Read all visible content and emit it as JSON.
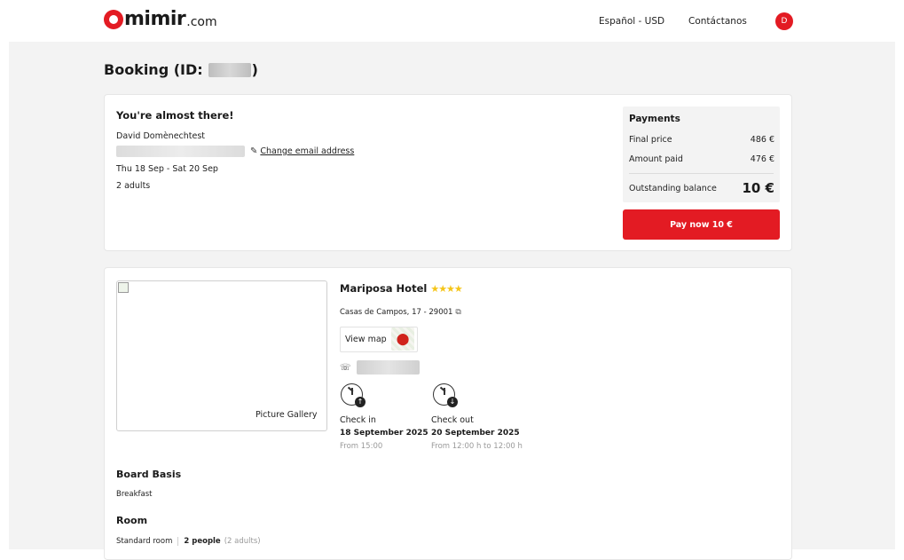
{
  "header": {
    "logo_word": "mimir",
    "logo_suffix": ".com",
    "language": "Español - USD",
    "contact": "Contáctanos",
    "avatar_initial": "D"
  },
  "booking": {
    "title_prefix": "Booking (ID:",
    "title_suffix": ")"
  },
  "summary": {
    "heading": "You're almost there!",
    "guest_name": "David Domènechtest",
    "change_email": "Change email address",
    "dates": "Thu 18 Sep - Sat 20 Sep",
    "guests": "2 adults"
  },
  "payments": {
    "title": "Payments",
    "final_price_label": "Final price",
    "final_price_value": "486 €",
    "amount_paid_label": "Amount paid",
    "amount_paid_value": "476 €",
    "outstanding_label": "Outstanding balance",
    "outstanding_value": "10 €",
    "pay_button": "Pay now 10 €"
  },
  "hotel": {
    "name": "Mariposa Hotel",
    "stars": "★★★★",
    "address": "Casas de Campos, 17 - 29001",
    "view_map": "View map",
    "gallery_label": "Picture Gallery",
    "check_in_label": "Check in",
    "check_in_date": "18 September 2025",
    "check_in_time": "From 15:00",
    "check_out_label": "Check out",
    "check_out_date": "20 September 2025",
    "check_out_time": "From 12:00 h to 12:00 h"
  },
  "board": {
    "title": "Board Basis",
    "value": "Breakfast"
  },
  "room": {
    "title": "Room",
    "type": "Standard room",
    "people": "2 people",
    "adults": "(2 adults)"
  },
  "colors": {
    "brand_red": "#e31b23",
    "star_yellow": "#f5c518"
  }
}
